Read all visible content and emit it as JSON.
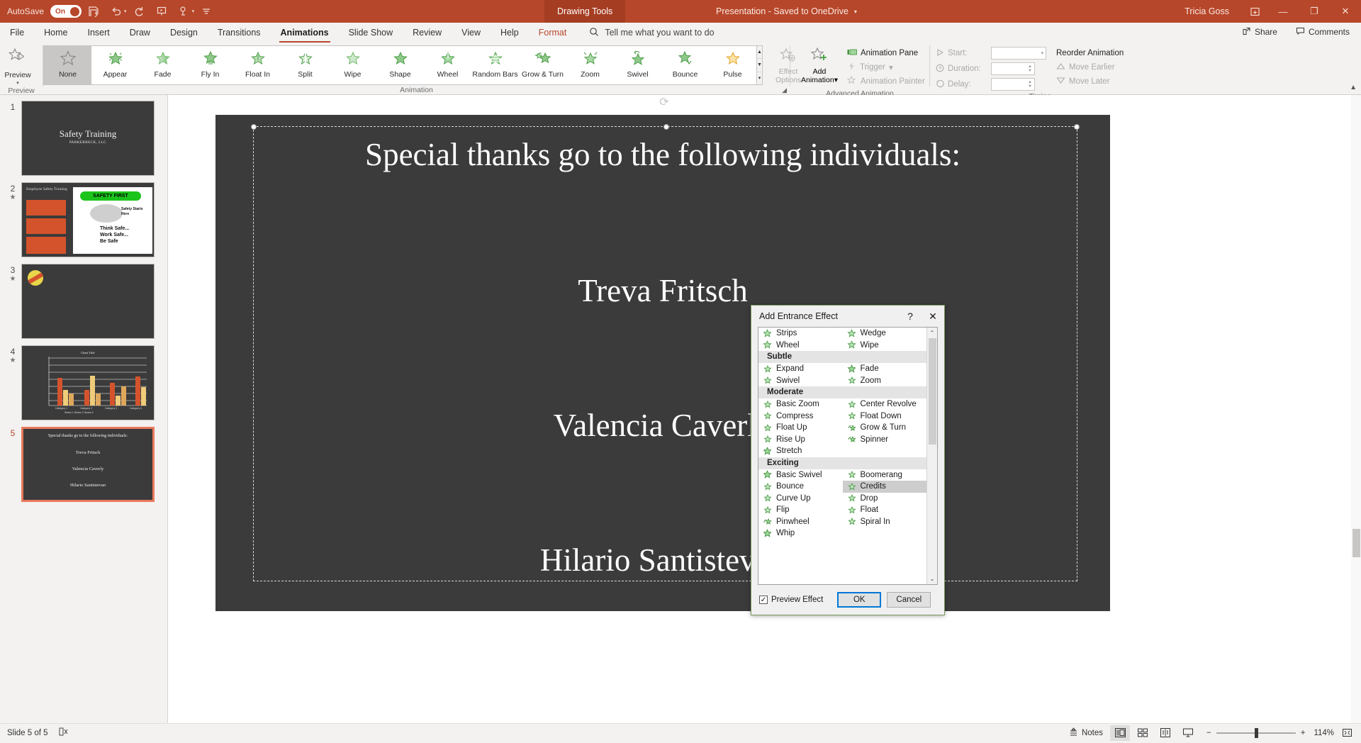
{
  "titlebar": {
    "autosave_label": "AutoSave",
    "autosave_state": "On",
    "qat_icons": [
      "save-icon",
      "undo-icon",
      "redo-icon",
      "start-slideshow-icon",
      "touch-mode-icon",
      "customize-qat-icon"
    ],
    "contextual_tab": "Drawing Tools",
    "doc_title": "Presentation  -  Saved to OneDrive",
    "account_name": "Tricia Goss",
    "ribbon_display_icon": "ribbon-display-options-icon",
    "minimize": "—",
    "restore": "❐",
    "close": "✕"
  },
  "tabs": [
    {
      "label": "File",
      "active": false,
      "contextual": false
    },
    {
      "label": "Home",
      "active": false,
      "contextual": false
    },
    {
      "label": "Insert",
      "active": false,
      "contextual": false
    },
    {
      "label": "Draw",
      "active": false,
      "contextual": false
    },
    {
      "label": "Design",
      "active": false,
      "contextual": false
    },
    {
      "label": "Transitions",
      "active": false,
      "contextual": false
    },
    {
      "label": "Animations",
      "active": true,
      "contextual": false
    },
    {
      "label": "Slide Show",
      "active": false,
      "contextual": false
    },
    {
      "label": "Review",
      "active": false,
      "contextual": false
    },
    {
      "label": "View",
      "active": false,
      "contextual": false
    },
    {
      "label": "Help",
      "active": false,
      "contextual": false
    },
    {
      "label": "Format",
      "active": false,
      "contextual": true
    }
  ],
  "tellme": {
    "icon": "search-icon",
    "placeholder": "Tell me what you want to do"
  },
  "tabrow_right": [
    {
      "label": "Share",
      "icon": "share-icon"
    },
    {
      "label": "Comments",
      "icon": "comments-icon"
    }
  ],
  "ribbon": {
    "preview": {
      "label": "Preview",
      "group_label": "Preview",
      "caret": "▾"
    },
    "animation_group_label": "Animation",
    "gallery": [
      {
        "label": "None",
        "icon": "star-outline-icon",
        "selected": true
      },
      {
        "label": "Appear",
        "icon": "star-appear-icon",
        "selected": false
      },
      {
        "label": "Fade",
        "icon": "star-fade-icon",
        "selected": false
      },
      {
        "label": "Fly In",
        "icon": "star-flyin-icon",
        "selected": false
      },
      {
        "label": "Float In",
        "icon": "star-floatin-icon",
        "selected": false
      },
      {
        "label": "Split",
        "icon": "star-split-icon",
        "selected": false
      },
      {
        "label": "Wipe",
        "icon": "star-wipe-icon",
        "selected": false
      },
      {
        "label": "Shape",
        "icon": "star-shape-icon",
        "selected": false
      },
      {
        "label": "Wheel",
        "icon": "star-wheel-icon",
        "selected": false
      },
      {
        "label": "Random Bars",
        "icon": "star-randombars-icon",
        "selected": false
      },
      {
        "label": "Grow & Turn",
        "icon": "star-growturn-icon",
        "selected": false
      },
      {
        "label": "Zoom",
        "icon": "star-zoom-icon",
        "selected": false
      },
      {
        "label": "Swivel",
        "icon": "star-swivel-icon",
        "selected": false
      },
      {
        "label": "Bounce",
        "icon": "star-bounce-icon",
        "selected": false
      },
      {
        "label": "Pulse",
        "icon": "star-pulse-icon",
        "selected": false
      }
    ],
    "gallery_scroll": {
      "up": "▲",
      "down": "▼",
      "more": "▾"
    },
    "effect_options": {
      "line1": "Effect",
      "line2": "Options",
      "caret": "▾",
      "icon": "effect-options-icon",
      "disabled": true
    },
    "advanced": {
      "group_label": "Advanced Animation",
      "add_animation": {
        "line1": "Add",
        "line2": "Animation",
        "caret": "▾",
        "icon": "add-animation-icon"
      },
      "animation_pane": {
        "label": "Animation Pane",
        "icon": "animation-pane-icon",
        "disabled": false
      },
      "trigger": {
        "label": "Trigger",
        "caret": "▾",
        "icon": "trigger-icon",
        "disabled": true
      },
      "animation_painter": {
        "label": "Animation Painter",
        "icon": "animation-painter-icon",
        "disabled": true
      }
    },
    "timing": {
      "group_label": "Timing",
      "start": {
        "label": "Start:",
        "value": "",
        "icon": "play-icon"
      },
      "duration": {
        "label": "Duration:",
        "value": "",
        "icon": "clock-icon"
      },
      "delay": {
        "label": "Delay:",
        "value": "",
        "icon": "delay-clock-icon"
      },
      "reorder_title": "Reorder Animation",
      "move_earlier": {
        "label": "Move Earlier",
        "icon": "triangle-up-icon"
      },
      "move_later": {
        "label": "Move Later",
        "icon": "triangle-down-icon"
      }
    },
    "collapse_icon": "collapse-ribbon-icon"
  },
  "thumbnails": [
    {
      "number": "1",
      "animated": false,
      "current": false,
      "title": "Safety Training",
      "subtitle": "PARKERBECK, LLC"
    },
    {
      "number": "2",
      "animated": true,
      "current": false,
      "title": "Employee Safety Training",
      "badge": "SAFETY FIRST"
    },
    {
      "number": "3",
      "animated": true,
      "current": false,
      "title": ""
    },
    {
      "number": "4",
      "animated": true,
      "current": false,
      "title": "Chart Title"
    },
    {
      "number": "5",
      "animated": false,
      "current": true,
      "title": "Special thanks go to the following individuals:",
      "lines": [
        "Treva Fritsch",
        "Valencia Caverly",
        "Hilario Santistevan"
      ]
    }
  ],
  "slide": {
    "title": "Special thanks go to the following individuals:",
    "line1": "Treva Fritsch",
    "line2": "Valencia Caverly",
    "line3": "Hilario Santistevan",
    "rotate_icon": "rotate-handle-icon"
  },
  "dialog": {
    "title": "Add Entrance Effect",
    "help_icon": "?",
    "close_icon": "✕",
    "groups": [
      {
        "section": null,
        "items": [
          {
            "label": "Strips",
            "selected": false
          },
          {
            "label": "Wedge",
            "selected": false
          },
          {
            "label": "Wheel",
            "selected": false
          },
          {
            "label": "Wipe",
            "selected": false
          }
        ]
      },
      {
        "section": "Subtle",
        "items": [
          {
            "label": "Expand",
            "selected": false
          },
          {
            "label": "Fade",
            "selected": false
          },
          {
            "label": "Swivel",
            "selected": false
          },
          {
            "label": "Zoom",
            "selected": false
          }
        ]
      },
      {
        "section": "Moderate",
        "items": [
          {
            "label": "Basic Zoom",
            "selected": false
          },
          {
            "label": "Center Revolve",
            "selected": false
          },
          {
            "label": "Compress",
            "selected": false
          },
          {
            "label": "Float Down",
            "selected": false
          },
          {
            "label": "Float Up",
            "selected": false
          },
          {
            "label": "Grow & Turn",
            "selected": false
          },
          {
            "label": "Rise Up",
            "selected": false
          },
          {
            "label": "Spinner",
            "selected": false
          },
          {
            "label": "Stretch",
            "selected": false
          },
          {
            "label": "",
            "selected": false
          }
        ]
      },
      {
        "section": "Exciting",
        "items": [
          {
            "label": "Basic Swivel",
            "selected": false
          },
          {
            "label": "Boomerang",
            "selected": false
          },
          {
            "label": "Bounce",
            "selected": false
          },
          {
            "label": "Credits",
            "selected": true
          },
          {
            "label": "Curve Up",
            "selected": false
          },
          {
            "label": "Drop",
            "selected": false
          },
          {
            "label": "Flip",
            "selected": false
          },
          {
            "label": "Float",
            "selected": false
          },
          {
            "label": "Pinwheel",
            "selected": false
          },
          {
            "label": "Spiral In",
            "selected": false
          },
          {
            "label": "Whip",
            "selected": false
          },
          {
            "label": "",
            "selected": false
          }
        ]
      }
    ],
    "preview_effect": {
      "label": "Preview Effect",
      "checked": true,
      "check_glyph": "✓"
    },
    "ok_label": "OK",
    "cancel_label": "Cancel",
    "scroll_up": "⌃",
    "scroll_down": "⌄"
  },
  "statusbar": {
    "slide_indicator": "Slide 5 of 5",
    "accessibility_icon": "accessibility-check-icon",
    "notes_label": "Notes",
    "notes_icon": "notes-icon",
    "views": [
      {
        "icon": "normal-view-icon",
        "active": true
      },
      {
        "icon": "slide-sorter-icon",
        "active": false
      },
      {
        "icon": "reading-view-icon",
        "active": false
      },
      {
        "icon": "slideshow-icon",
        "active": false
      }
    ],
    "zoom_out": "−",
    "zoom_in": "+",
    "zoom_level": "114%",
    "fit_icon": "fit-slide-icon"
  },
  "colors": {
    "brand": "#b7472a",
    "contextual_tab": "#a53d22",
    "slide_bg": "#3b3b3b",
    "accent_green": "#5aa653",
    "selection_orange": "#e8795a",
    "dialog_border": "#7a9a5b"
  }
}
